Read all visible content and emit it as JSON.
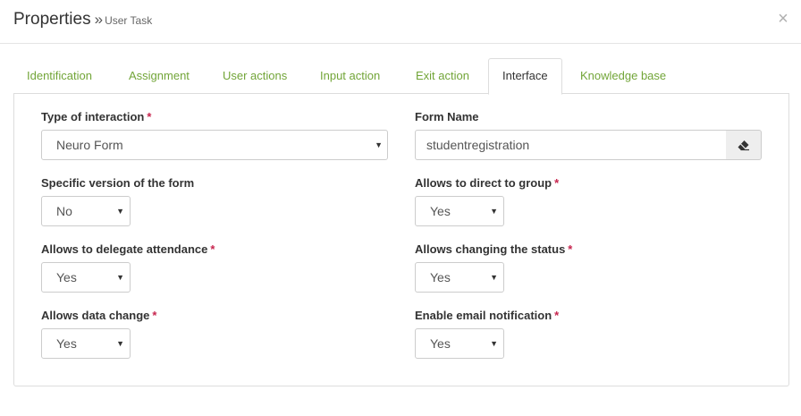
{
  "header": {
    "title": "Properties",
    "separator": "»",
    "subtitle": "User Task",
    "close_label": "×"
  },
  "tabs": [
    {
      "label": "Identification",
      "active": false
    },
    {
      "label": "Assignment",
      "active": false
    },
    {
      "label": "User actions",
      "active": false
    },
    {
      "label": "Input action",
      "active": false
    },
    {
      "label": "Exit action",
      "active": false
    },
    {
      "label": "Interface",
      "active": true
    },
    {
      "label": "Knowledge base",
      "active": false
    }
  ],
  "required_marker": "*",
  "fields": {
    "type_of_interaction": {
      "label": "Type of interaction",
      "value": "Neuro Form",
      "required": true
    },
    "form_name": {
      "label": "Form Name",
      "value": "studentregistration",
      "required": false
    },
    "specific_version": {
      "label": "Specific version of the form",
      "value": "No",
      "required": false
    },
    "direct_to_group": {
      "label": "Allows to direct to group",
      "value": "Yes",
      "required": true
    },
    "delegate_attendance": {
      "label": "Allows to delegate attendance",
      "value": "Yes",
      "required": true
    },
    "changing_status": {
      "label": "Allows changing the status",
      "value": "Yes",
      "required": true
    },
    "data_change": {
      "label": "Allows data change",
      "value": "Yes",
      "required": true
    },
    "email_notification": {
      "label": "Enable email notification",
      "value": "Yes",
      "required": true
    }
  },
  "icons": {
    "dropdown": "caret-down-icon",
    "clear": "eraser-icon",
    "close": "close-icon"
  },
  "colors": {
    "tab_link": "#72a538",
    "required": "#c7254e",
    "border": "#dddddd"
  }
}
